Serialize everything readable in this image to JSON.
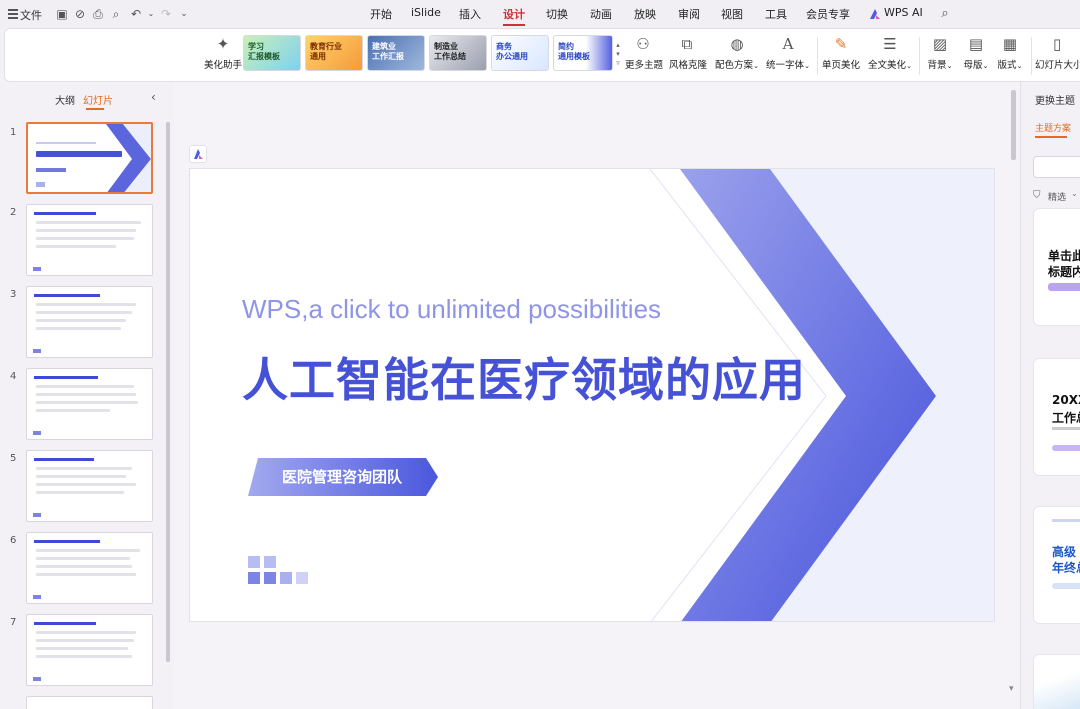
{
  "titlebar": {
    "file_menu": "文件",
    "tabs": [
      {
        "label": "开始"
      },
      {
        "label": "iSlide"
      },
      {
        "label": "插入"
      },
      {
        "label": "设计"
      },
      {
        "label": "切换"
      },
      {
        "label": "动画"
      },
      {
        "label": "放映"
      },
      {
        "label": "审阅"
      },
      {
        "label": "视图"
      },
      {
        "label": "工具"
      },
      {
        "label": "会员专享"
      },
      {
        "label": "WPS AI"
      }
    ],
    "active_tab": "设计"
  },
  "ribbon": {
    "beautify": "美化助手",
    "themes": [
      {
        "label": "学习\n汇报模板"
      },
      {
        "label": "教育行业\n通用"
      },
      {
        "label": "建筑业\n工作汇报"
      },
      {
        "label": "制造业\n工作总结"
      },
      {
        "label": "商务\n办公通用"
      },
      {
        "label": "简约\n通用模板"
      }
    ],
    "more_themes": "更多主题",
    "style_clone": "风格克隆",
    "color_scheme": "配色方案",
    "unify_font": "统一字体",
    "single_beautify": "单页美化",
    "full_beautify": "全文美化",
    "background": "背景",
    "master": "母版",
    "layout": "版式",
    "slide_size": "幻灯片大小"
  },
  "left_panel": {
    "tab_outline": "大纲",
    "tab_slides": "幻灯片",
    "slides": [
      {
        "num": "1"
      },
      {
        "num": "2"
      },
      {
        "num": "3"
      },
      {
        "num": "4"
      },
      {
        "num": "5"
      },
      {
        "num": "6"
      },
      {
        "num": "7"
      }
    ]
  },
  "slide": {
    "subtitle": "WPS,a click to unlimited possibilities",
    "title": "人工智能在医疗领域的应用",
    "team": "医院管理咨询团队"
  },
  "right_panel": {
    "header": "更换主题",
    "tab": "主题方案",
    "filter": "精选",
    "cards": [
      {
        "line1": "单击此",
        "line2": "标题内"
      },
      {
        "line1": "20XX",
        "line2": "工作总"
      },
      {
        "line1": "高级",
        "line2": "年终总"
      }
    ]
  },
  "colors": {
    "accent": "#c8343a",
    "slide_blue": "#4552d6",
    "slide_light_blue": "#8f95e6",
    "selection": "#e97a3b"
  }
}
